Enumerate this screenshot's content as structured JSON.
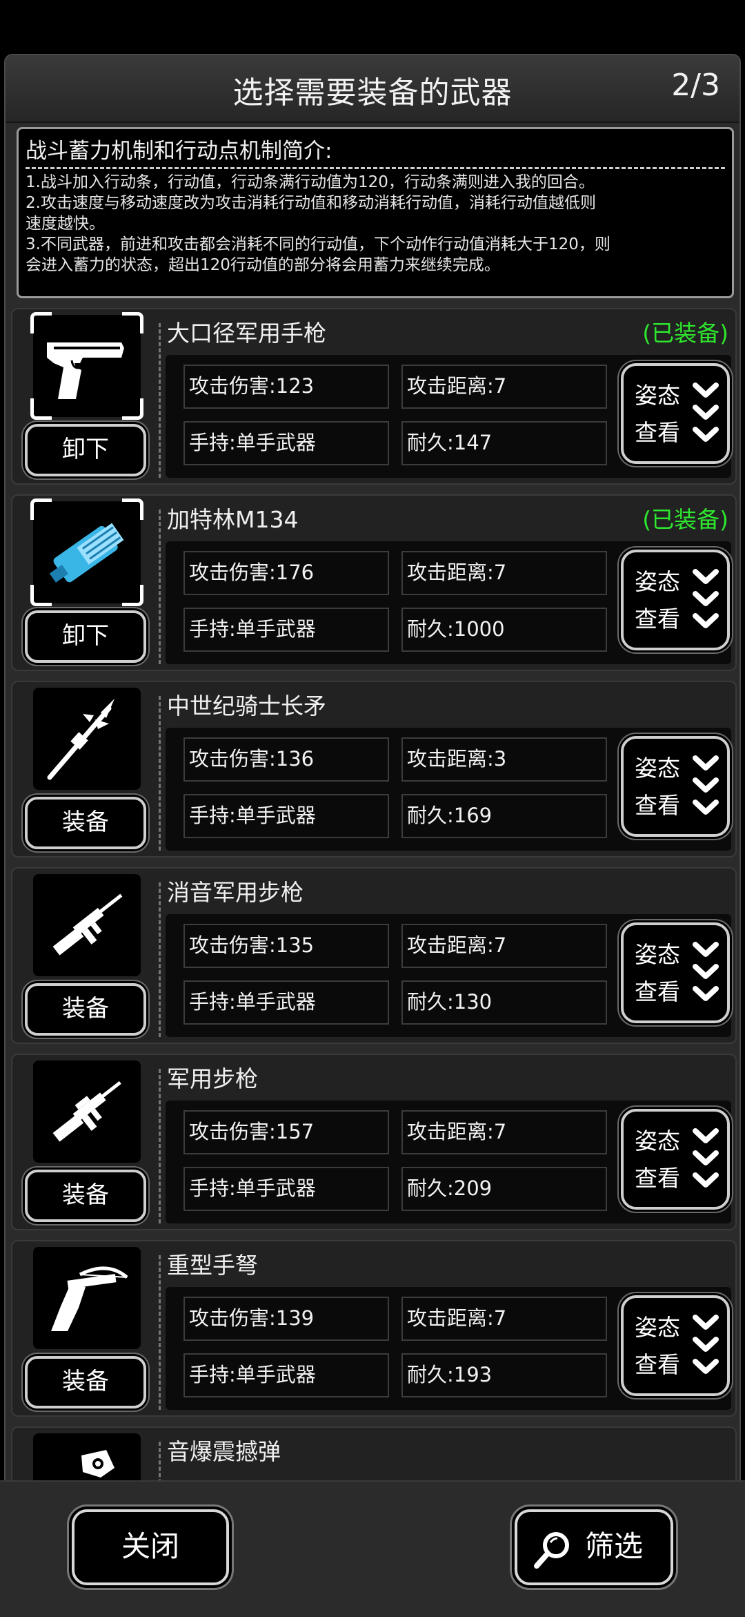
{
  "header": {
    "title": "选择需要装备的武器",
    "page": "2/3"
  },
  "intro": {
    "title": "战斗蓄力机制和行动点机制简介:",
    "lines": [
      "1.战斗加入行动条，行动值，行动条满行动值为120，行动条满则进入我的回合。",
      "2.攻击速度与移动速度改为攻击消耗行动值和移动消耗行动值，消耗行动值越低则",
      "速度越快。",
      "3.不同武器，前进和攻击都会消耗不同的行动值，下个动作行动值消耗大于120，则",
      "会进入蓄力的状态，超出120行动值的部分将会用蓄力来继续完成。"
    ]
  },
  "weapons": [
    {
      "name": "大口径军用手枪",
      "equipped": "(已装备)",
      "action": "卸下",
      "icon": "pistol-icon",
      "damage": "攻击伤害:123",
      "range": "攻击距离:7",
      "hand": "手持:单手武器",
      "durability": "耐久:147"
    },
    {
      "name": "加特林M134",
      "equipped": "(已装备)",
      "action": "卸下",
      "icon": "gatling-icon",
      "damage": "攻击伤害:176",
      "range": "攻击距离:7",
      "hand": "手持:单手武器",
      "durability": "耐久:1000"
    },
    {
      "name": "中世纪骑士长矛",
      "equipped": "",
      "action": "装备",
      "icon": "spear-icon",
      "damage": "攻击伤害:136",
      "range": "攻击距离:3",
      "hand": "手持:单手武器",
      "durability": "耐久:169"
    },
    {
      "name": "消音军用步枪",
      "equipped": "",
      "action": "装备",
      "icon": "rifle-icon",
      "damage": "攻击伤害:135",
      "range": "攻击距离:7",
      "hand": "手持:单手武器",
      "durability": "耐久:130"
    },
    {
      "name": "军用步枪",
      "equipped": "",
      "action": "装备",
      "icon": "rifle-icon",
      "damage": "攻击伤害:157",
      "range": "攻击距离:7",
      "hand": "手持:单手武器",
      "durability": "耐久:209"
    },
    {
      "name": "重型手弩",
      "equipped": "",
      "action": "装备",
      "icon": "crossbow-icon",
      "damage": "攻击伤害:139",
      "range": "攻击距离:7",
      "hand": "手持:单手武器",
      "durability": "耐久:193"
    },
    {
      "name": "音爆震撼弹",
      "equipped": "",
      "action": "",
      "icon": "grenade-icon",
      "damage": "",
      "range": "",
      "hand": "",
      "durability": ""
    }
  ],
  "view_button": {
    "line1": "姿态",
    "line2": "查看"
  },
  "footer": {
    "close": "关闭",
    "filter": "筛选"
  },
  "colors": {
    "equipped": "#2ee62e",
    "background": "#2b2b2b"
  }
}
